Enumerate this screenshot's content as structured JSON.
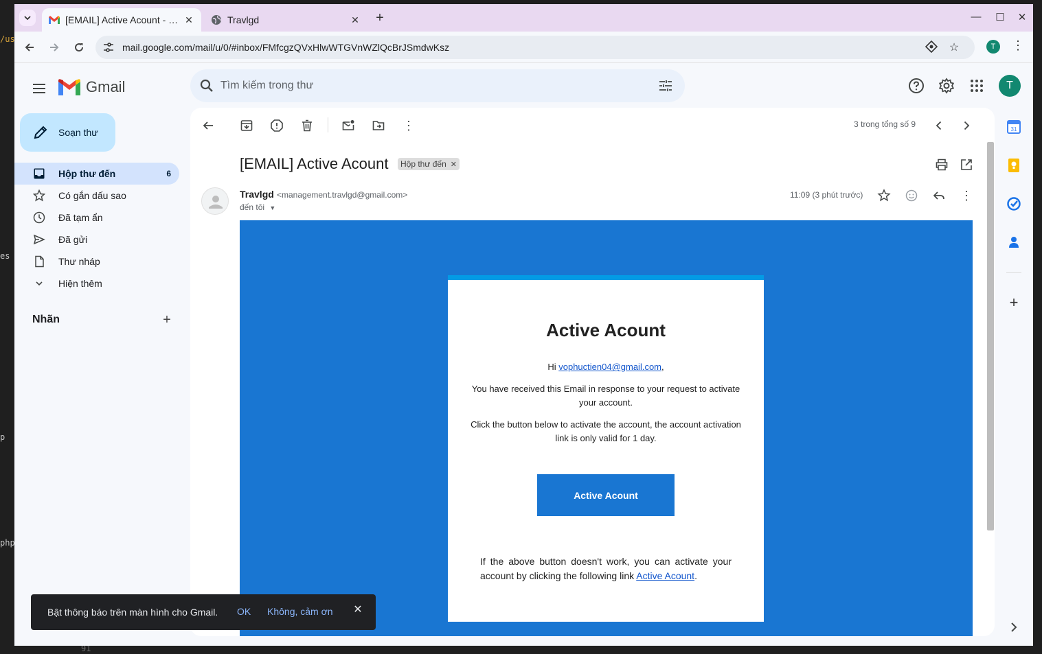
{
  "browser": {
    "tabs": [
      {
        "title": "[EMAIL] Active Acount - …",
        "active": true
      },
      {
        "title": "Travlgd",
        "active": false
      }
    ],
    "url": "mail.google.com/mail/u/0/#inbox/FMfcgzQVxHlwWTGVnWZlQcBrJSmdwKsz",
    "profile_initial": "T"
  },
  "gmail": {
    "logo_text": "Gmail",
    "search_placeholder": "Tìm kiếm trong thư",
    "avatar_initial": "T",
    "compose_label": "Soạn thư",
    "nav": [
      {
        "label": "Hộp thư đến",
        "count": "6",
        "icon": "inbox-icon"
      },
      {
        "label": "Có gắn dấu sao",
        "count": "",
        "icon": "star-icon"
      },
      {
        "label": "Đã tạm ẩn",
        "count": "",
        "icon": "clock-icon"
      },
      {
        "label": "Đã gửi",
        "count": "",
        "icon": "send-icon"
      },
      {
        "label": "Thư nháp",
        "count": "",
        "icon": "draft-icon"
      },
      {
        "label": "Hiện thêm",
        "count": "",
        "icon": "chevron-down-icon"
      }
    ],
    "labels_heading": "Nhãn"
  },
  "message": {
    "pager": "3 trong tổng số 9",
    "subject": "[EMAIL] Active Acount",
    "label_chip": "Hộp thư đến",
    "sender_name": "Travlgd",
    "sender_email": "<management.travlgd@gmail.com>",
    "to": "đến tôi",
    "time": "11:09 (3 phút trước)"
  },
  "email_body": {
    "heading": "Active Acount",
    "greeting_prefix": "Hi ",
    "greeting_email": "vophuctien04@gmail.com",
    "greeting_suffix": ",",
    "para1": "You have received this Email in response to your request to activate your account.",
    "para2": "Click the button below to activate the account, the account activation link is only valid for 1 day.",
    "button_label": "Active Acount",
    "footer_text": "If the above button doesn't work, you can activate your account by clicking the following link ",
    "footer_link": "Active Acount",
    "footer_end": "."
  },
  "snackbar": {
    "text": "Bật thông báo trên màn hình cho Gmail.",
    "ok": "OK",
    "no": "Không, cảm ơn"
  },
  "background": {
    "left_fragments": [
      "/us",
      "es",
      "p",
      "php"
    ],
    "bottom_line_number": "91"
  },
  "colors": {
    "accent": "#1976d2",
    "card_top_border": "#039be5",
    "compose_bg": "#c2e7ff",
    "nav_active": "#d3e3fd",
    "tabbar": "#e9d9f1"
  }
}
